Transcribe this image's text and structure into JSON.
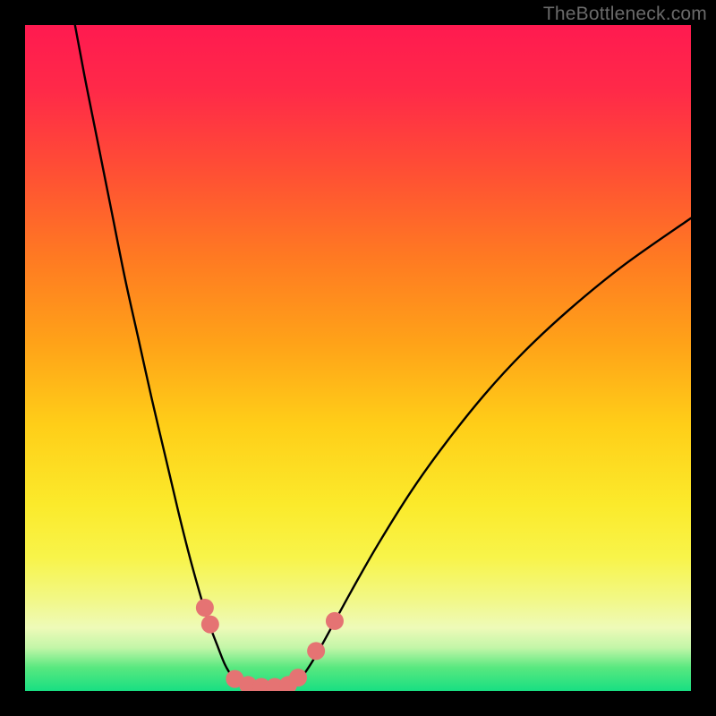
{
  "watermark": "TheBottleneck.com",
  "gradient": {
    "stops": [
      {
        "offset": 0.0,
        "color": "#ff1a50"
      },
      {
        "offset": 0.1,
        "color": "#ff2a48"
      },
      {
        "offset": 0.22,
        "color": "#ff4f34"
      },
      {
        "offset": 0.35,
        "color": "#ff7a22"
      },
      {
        "offset": 0.48,
        "color": "#ffa318"
      },
      {
        "offset": 0.6,
        "color": "#ffce18"
      },
      {
        "offset": 0.72,
        "color": "#fbea2b"
      },
      {
        "offset": 0.8,
        "color": "#f8f44a"
      },
      {
        "offset": 0.86,
        "color": "#f2f884"
      },
      {
        "offset": 0.905,
        "color": "#eefab8"
      },
      {
        "offset": 0.935,
        "color": "#c3f6a8"
      },
      {
        "offset": 0.965,
        "color": "#58e87f"
      },
      {
        "offset": 1.0,
        "color": "#18df82"
      }
    ]
  },
  "chart_data": {
    "type": "line",
    "title": "",
    "xlabel": "",
    "ylabel": "",
    "xlim": [
      0,
      100
    ],
    "ylim": [
      0,
      100
    ],
    "series": [
      {
        "name": "curve-left-branch",
        "x": [
          7.5,
          9,
          11,
          13,
          15,
          17,
          19,
          21,
          23,
          24.5,
          26,
          27.5,
          29,
          30,
          31,
          32,
          33
        ],
        "y": [
          100,
          92,
          82,
          72,
          62,
          53,
          44,
          35.5,
          27,
          21,
          15.5,
          10.5,
          6.5,
          4,
          2.3,
          1.2,
          0.6
        ]
      },
      {
        "name": "curve-right-branch",
        "x": [
          40,
          41.5,
          43.5,
          46,
          49,
          53,
          58,
          63,
          69,
          75,
          82,
          90,
          100
        ],
        "y": [
          0.6,
          2,
          5,
          9.5,
          15,
          22,
          30,
          37,
          44.5,
          51,
          57.5,
          64,
          71
        ]
      },
      {
        "name": "valley-floor",
        "x": [
          33,
          34.5,
          36.5,
          38.5,
          40
        ],
        "y": [
          0.6,
          0.2,
          0.1,
          0.2,
          0.6
        ]
      }
    ],
    "markers": {
      "name": "marker-dots",
      "color": "#e57373",
      "radius_px": 10,
      "points": [
        {
          "x": 27.0,
          "y": 12.5
        },
        {
          "x": 27.8,
          "y": 10.0
        },
        {
          "x": 31.5,
          "y": 1.8
        },
        {
          "x": 33.5,
          "y": 0.9
        },
        {
          "x": 35.5,
          "y": 0.6
        },
        {
          "x": 37.5,
          "y": 0.6
        },
        {
          "x": 39.5,
          "y": 0.9
        },
        {
          "x": 41.0,
          "y": 2.0
        },
        {
          "x": 43.7,
          "y": 6.0
        },
        {
          "x": 46.5,
          "y": 10.5
        }
      ]
    }
  }
}
